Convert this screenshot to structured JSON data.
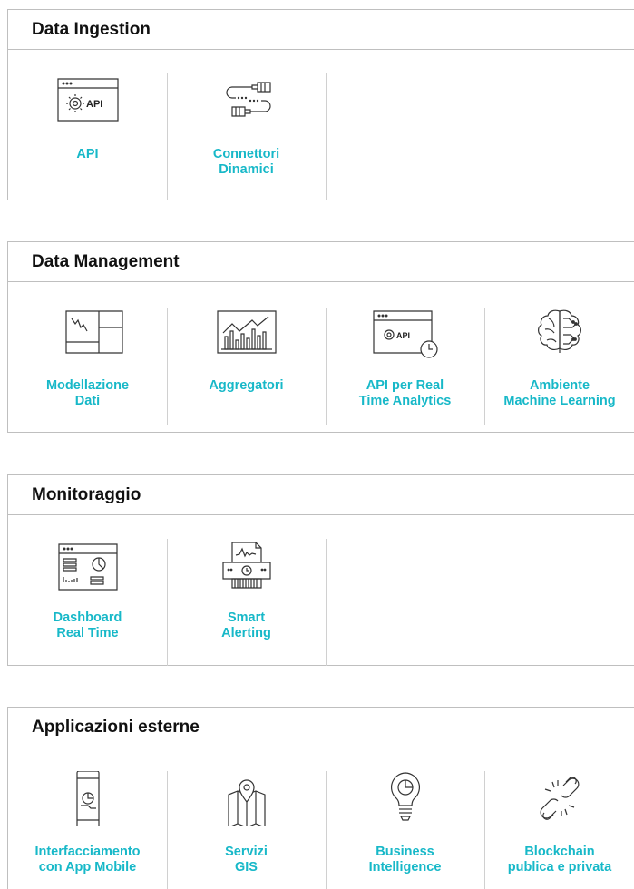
{
  "accent_color": "#17b8c8",
  "sections": [
    {
      "title": "Data Ingestion",
      "items": [
        {
          "label": "API",
          "icon": "api-window-icon"
        },
        {
          "label": "Connettori\nDinamici",
          "icon": "cable-connector-icon"
        }
      ]
    },
    {
      "title": "Data Management",
      "items": [
        {
          "label": "Modellazione\nDati",
          "icon": "data-model-icon"
        },
        {
          "label": "Aggregatori",
          "icon": "bar-chart-icon"
        },
        {
          "label": "API per Real\nTime Analytics",
          "icon": "api-clock-icon"
        },
        {
          "label": "Ambiente\nMachine Learning",
          "icon": "brain-icon"
        }
      ]
    },
    {
      "title": "Monitoraggio",
      "items": [
        {
          "label": "Dashboard\nReal Time",
          "icon": "dashboard-icon"
        },
        {
          "label": "Smart\nAlerting",
          "icon": "printer-alert-icon"
        }
      ]
    },
    {
      "title": "Applicazioni esterne",
      "items": [
        {
          "label": "Interfacciamento\ncon App Mobile",
          "icon": "mobile-app-icon"
        },
        {
          "label": "Servizi\nGIS",
          "icon": "map-pin-icon"
        },
        {
          "label": "Business\nIntelligence",
          "icon": "lightbulb-icon"
        },
        {
          "label": "Blockchain\npublica e privata",
          "icon": "broken-chain-icon"
        }
      ]
    }
  ],
  "api_icon_text": "API"
}
